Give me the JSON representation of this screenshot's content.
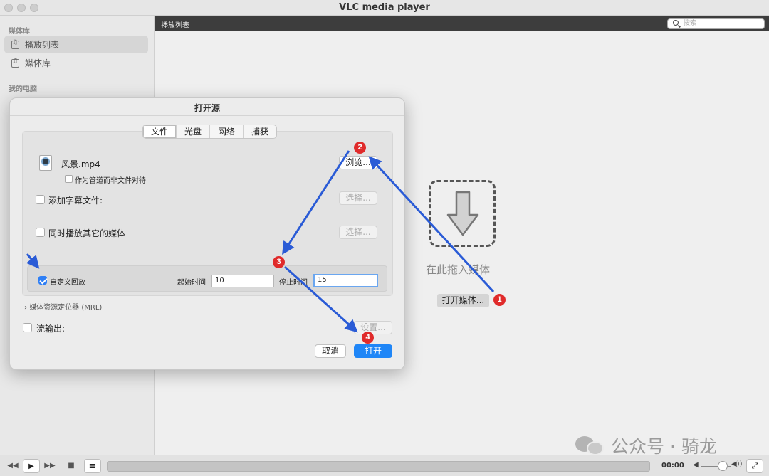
{
  "window": {
    "title": "VLC media player"
  },
  "sidebar": {
    "section_media": "媒体库",
    "items": [
      {
        "label": "播放列表"
      },
      {
        "label": "媒体库"
      }
    ],
    "section_computer": "我的电脑"
  },
  "playlist": {
    "header": "播放列表",
    "search_placeholder": "搜索",
    "drop_label": "在此拖入媒体",
    "open_media_button": "打开媒体..."
  },
  "dialog": {
    "title": "打开源",
    "tabs": [
      "文件",
      "光盘",
      "网络",
      "捕获"
    ],
    "active_tab": "文件",
    "file_name": "风景.mp4",
    "pipe_option": "作为管道而非文件对待",
    "browse_button": "浏览...",
    "subtitle_label": "添加字幕文件:",
    "choose_button": "选择...",
    "play_other_label": "同时播放其它的媒体",
    "custom_playback_label": "自定义回放",
    "start_time_label": "起始时间",
    "start_time_value": "10",
    "stop_time_label": "停止时间",
    "stop_time_value": "15",
    "mrl_label": "媒体资源定位器 (MRL)",
    "stream_output_label": "流输出:",
    "settings_button": "设置...",
    "cancel_button": "取消",
    "open_button": "打开"
  },
  "controls": {
    "time": "00:00",
    "rewind_icon": "rewind-icon",
    "play_icon": "play-icon",
    "forward_icon": "fast-forward-icon",
    "stop_icon": "stop-icon",
    "playlist_icon": "playlist-icon"
  },
  "annotations": {
    "badges": [
      "1",
      "2",
      "3",
      "4"
    ],
    "color": "#e02b2b",
    "arrow_color": "#2a5bd6"
  },
  "watermark": {
    "text": "公众号 · 骑龙"
  }
}
